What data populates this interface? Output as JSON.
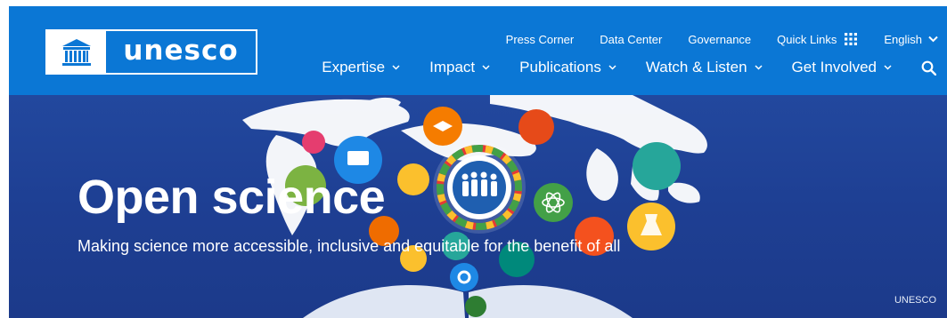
{
  "header": {
    "logo_text": "unesco",
    "top_nav": [
      "Press Corner",
      "Data Center",
      "Governance"
    ],
    "quick_links_label": "Quick Links",
    "language_label": "English",
    "main_nav": [
      "Expertise",
      "Impact",
      "Publications",
      "Watch & Listen",
      "Get Involved"
    ]
  },
  "hero": {
    "title": "Open science",
    "subtitle": "Making science more accessible, inclusive and equitable for the benefit of all",
    "credit": "UNESCO"
  },
  "colors": {
    "header_blue": "#0b77d5",
    "hero_blue": "#1e3f93"
  }
}
